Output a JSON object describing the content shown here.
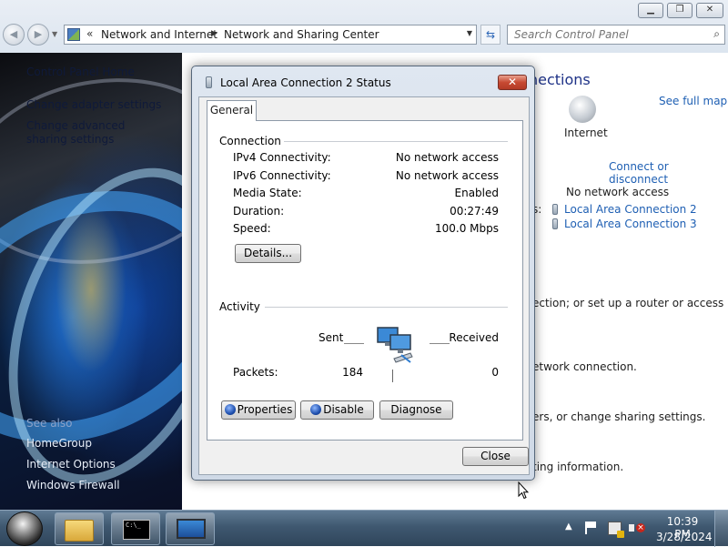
{
  "window": {
    "min_label": "▁",
    "max_label": "❐",
    "close_label": "✕"
  },
  "nav": {
    "back_icon": "◀",
    "forward_icon": "▶",
    "recent_icon": "▼"
  },
  "address": {
    "overflow": "«",
    "crumbs": [
      "Network and Internet",
      "Network and Sharing Center"
    ],
    "separator": "▶",
    "dropdown": "▼",
    "refresh_icon": "⇆"
  },
  "search": {
    "placeholder": "Search Control Panel",
    "icon": "⌕"
  },
  "leftnav": {
    "items": [
      "Control Panel Home",
      "Change adapter settings",
      "Change advanced sharing settings"
    ],
    "see_also": "See also",
    "bottom_items": [
      "HomeGroup",
      "Internet Options",
      "Windows Firewall"
    ]
  },
  "main": {
    "heading": "nections",
    "internet_label": "Internet",
    "see_full_map": "See full map",
    "connect_or_disconnect": "Connect or disconnect",
    "access_type_colon": ":",
    "access_type_value": "No network access",
    "connections_colon": "s:",
    "connections": [
      "Local Area Connection 2",
      "Local Area Connection 3"
    ],
    "fragments": [
      "ection; or set up a router or access",
      "etwork connection.",
      "ers, or change sharing settings.",
      "ting information."
    ]
  },
  "dialog": {
    "title": "Local Area Connection 2 Status",
    "close_label": "✕",
    "tab": "General",
    "connection_group": "Connection",
    "properties": [
      {
        "label": "IPv4 Connectivity:",
        "value": "No network access"
      },
      {
        "label": "IPv6 Connectivity:",
        "value": "No network access"
      },
      {
        "label": "Media State:",
        "value": "Enabled"
      },
      {
        "label": "Duration:",
        "value": "00:27:49"
      },
      {
        "label": "Speed:",
        "value": "100.0 Mbps"
      }
    ],
    "details_button": "Details...",
    "activity_group": "Activity",
    "sent_label": "Sent",
    "received_label": "Received",
    "packets_label": "Packets:",
    "packets_sent": "184",
    "packets_received": "0",
    "buttons": {
      "properties": "Properties",
      "disable": "Disable",
      "diagnose": "Diagnose",
      "close": "Close"
    }
  },
  "taskbar": {
    "cmd_text": "C:\\_",
    "clock_time": "10:39 PM",
    "clock_date": "3/28/2024",
    "tray_arrow": "▲"
  }
}
